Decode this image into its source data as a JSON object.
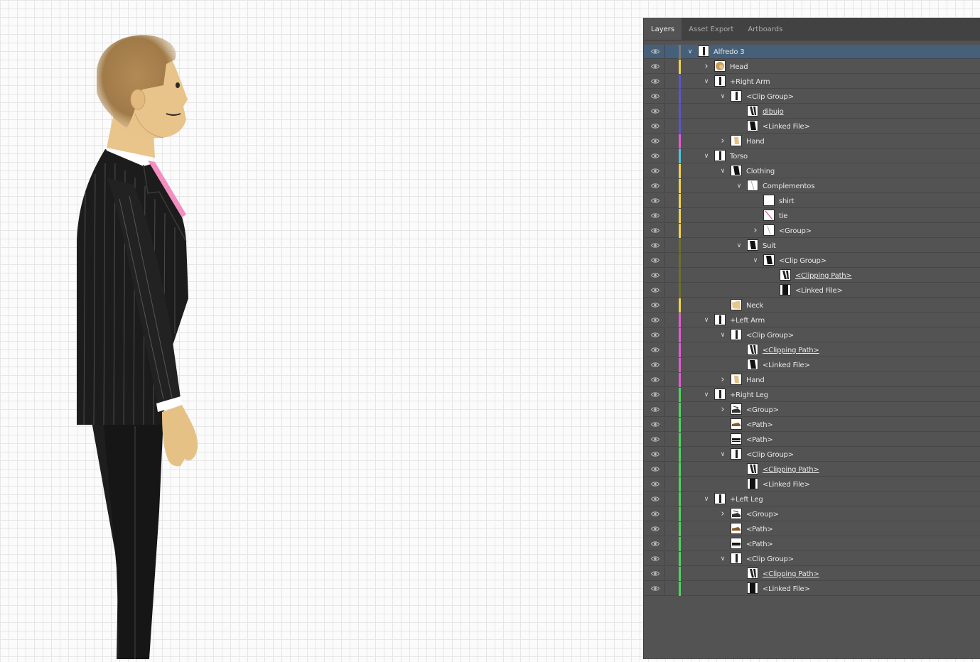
{
  "tabs": [
    {
      "label": "Layers",
      "active": true
    },
    {
      "label": "Asset Export",
      "active": false
    },
    {
      "label": "Artboards",
      "active": false
    }
  ],
  "layers": [
    {
      "name": "Alfredo 3",
      "level": 0,
      "chevron": "down",
      "color": "#7a7a7a",
      "thumb": "figure",
      "selected": true,
      "underline": false
    },
    {
      "name": "Head",
      "level": 1,
      "chevron": "right",
      "color": "#f0d44c",
      "thumb": "head",
      "underline": false
    },
    {
      "name": "+Right Arm",
      "level": 1,
      "chevron": "down",
      "color": "#5b56c9",
      "thumb": "figure",
      "underline": false
    },
    {
      "name": "<Clip Group>",
      "level": 2,
      "chevron": "down",
      "color": "#5b56c9",
      "thumb": "figure",
      "underline": false
    },
    {
      "name": "dibujo",
      "level": 3,
      "chevron": "none",
      "color": "#5b56c9",
      "thumb": "stripes",
      "underline": true
    },
    {
      "name": "<Linked File>",
      "level": 3,
      "chevron": "none",
      "color": "#5b56c9",
      "thumb": "dark",
      "underline": false
    },
    {
      "name": "Hand",
      "level": 2,
      "chevron": "right",
      "color": "#e45bd6",
      "thumb": "hand",
      "underline": false
    },
    {
      "name": "Torso",
      "level": 1,
      "chevron": "down",
      "color": "#4fc8d8",
      "thumb": "figure",
      "underline": false
    },
    {
      "name": "Clothing",
      "level": 2,
      "chevron": "down",
      "color": "#f0d44c",
      "thumb": "dark",
      "underline": false
    },
    {
      "name": "Complementos",
      "level": 3,
      "chevron": "down",
      "color": "#f0d44c",
      "thumb": "line",
      "underline": false
    },
    {
      "name": "shirt",
      "level": 4,
      "chevron": "none",
      "color": "#f0d44c",
      "thumb": "blank",
      "underline": false
    },
    {
      "name": "tie",
      "level": 4,
      "chevron": "none",
      "color": "#f0d44c",
      "thumb": "tie",
      "underline": false
    },
    {
      "name": "<Group>",
      "level": 4,
      "chevron": "right",
      "color": "#f0d44c",
      "thumb": "line",
      "underline": false
    },
    {
      "name": "Suit",
      "level": 3,
      "chevron": "down",
      "color": "#6f6f2e",
      "thumb": "dark",
      "underline": false
    },
    {
      "name": "<Clip Group>",
      "level": 4,
      "chevron": "down",
      "color": "#6f6f2e",
      "thumb": "dark",
      "underline": false
    },
    {
      "name": "<Clipping Path>",
      "level": 5,
      "chevron": "none",
      "color": "#6f6f2e",
      "thumb": "stripes",
      "underline": true
    },
    {
      "name": "<Linked File>",
      "level": 5,
      "chevron": "none",
      "color": "#6f6f2e",
      "thumb": "darkbar",
      "underline": false
    },
    {
      "name": "Neck",
      "level": 2,
      "chevron": "none",
      "color": "#f0d44c",
      "thumb": "neck",
      "underline": false
    },
    {
      "name": "+Left Arm",
      "level": 1,
      "chevron": "down",
      "color": "#e45bd6",
      "thumb": "figure",
      "underline": false
    },
    {
      "name": "<Clip Group>",
      "level": 2,
      "chevron": "down",
      "color": "#e45bd6",
      "thumb": "figure",
      "underline": false
    },
    {
      "name": "<Clipping Path>",
      "level": 3,
      "chevron": "none",
      "color": "#e45bd6",
      "thumb": "stripes",
      "underline": true
    },
    {
      "name": "<Linked File>",
      "level": 3,
      "chevron": "none",
      "color": "#e45bd6",
      "thumb": "dark",
      "underline": false
    },
    {
      "name": "Hand",
      "level": 2,
      "chevron": "right",
      "color": "#e45bd6",
      "thumb": "hand",
      "underline": false
    },
    {
      "name": "+Right Leg",
      "level": 1,
      "chevron": "down",
      "color": "#4fd45b",
      "thumb": "figure",
      "underline": false
    },
    {
      "name": "<Group>",
      "level": 2,
      "chevron": "right",
      "color": "#4fd45b",
      "thumb": "shoe",
      "underline": false
    },
    {
      "name": "<Path>",
      "level": 2,
      "chevron": "none",
      "color": "#4fd45b",
      "thumb": "brownpath",
      "underline": false
    },
    {
      "name": "<Path>",
      "level": 2,
      "chevron": "none",
      "color": "#4fd45b",
      "thumb": "blackpath",
      "underline": false
    },
    {
      "name": "<Clip Group>",
      "level": 2,
      "chevron": "down",
      "color": "#4fd45b",
      "thumb": "figure",
      "underline": false
    },
    {
      "name": "<Clipping Path>",
      "level": 3,
      "chevron": "none",
      "color": "#4fd45b",
      "thumb": "stripes",
      "underline": true
    },
    {
      "name": "<Linked File>",
      "level": 3,
      "chevron": "none",
      "color": "#4fd45b",
      "thumb": "darkbar",
      "underline": false
    },
    {
      "name": "+Left Leg",
      "level": 1,
      "chevron": "down",
      "color": "#4fd45b",
      "thumb": "figure",
      "underline": false
    },
    {
      "name": "<Group>",
      "level": 2,
      "chevron": "right",
      "color": "#4fd45b",
      "thumb": "shoe",
      "underline": false
    },
    {
      "name": "<Path>",
      "level": 2,
      "chevron": "none",
      "color": "#4fd45b",
      "thumb": "brownpath",
      "underline": false
    },
    {
      "name": "<Path>",
      "level": 2,
      "chevron": "none",
      "color": "#4fd45b",
      "thumb": "blackpath",
      "underline": false
    },
    {
      "name": "<Clip Group>",
      "level": 2,
      "chevron": "down",
      "color": "#4fd45b",
      "thumb": "figure",
      "underline": false
    },
    {
      "name": "<Clipping Path>",
      "level": 3,
      "chevron": "none",
      "color": "#4fd45b",
      "thumb": "stripes",
      "underline": true
    },
    {
      "name": "<Linked File>",
      "level": 3,
      "chevron": "none",
      "color": "#4fd45b",
      "thumb": "darkbar",
      "underline": false
    }
  ]
}
